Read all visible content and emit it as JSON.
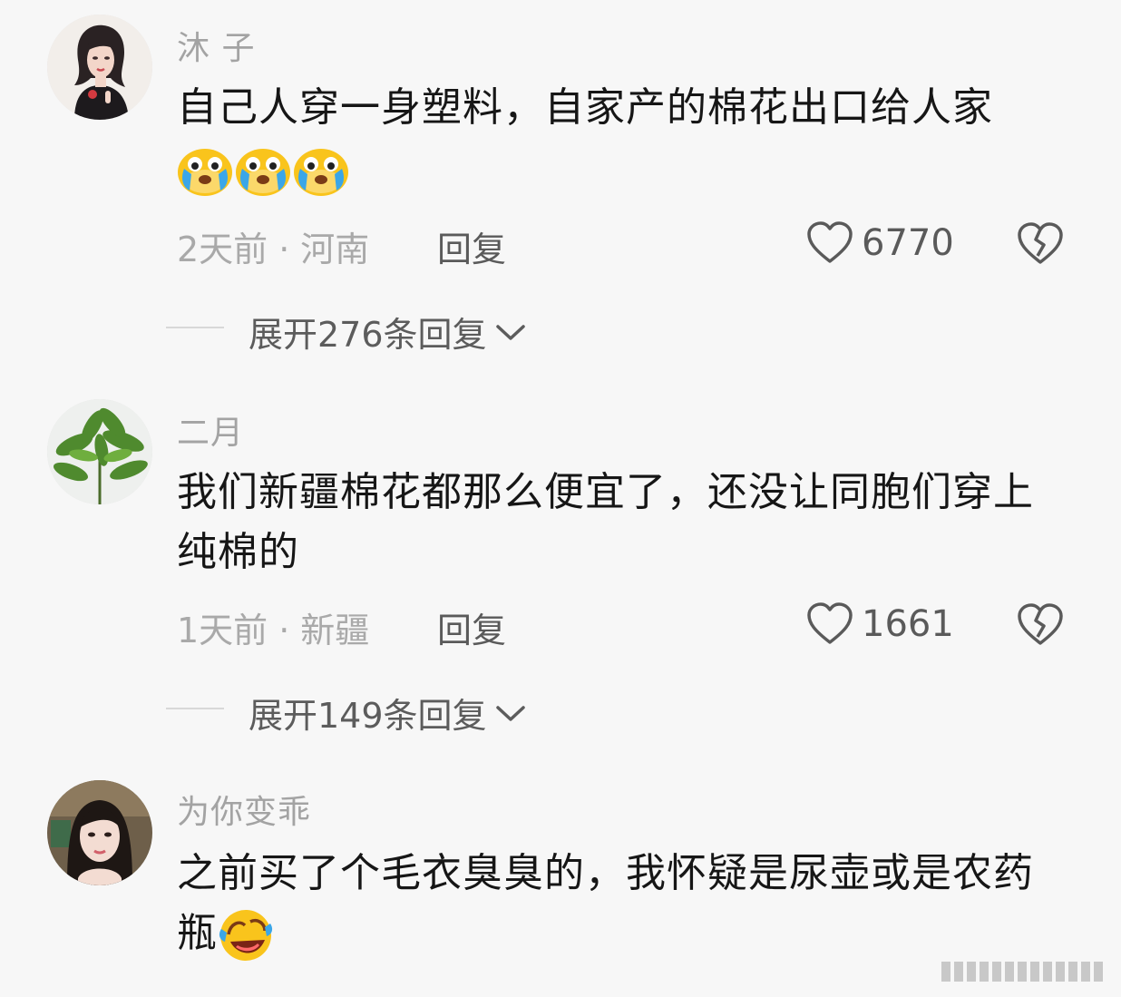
{
  "comments": [
    {
      "username": "沐 子",
      "text": "自己人穿一身塑料，自家产的棉花出口给人家",
      "emojis": [
        "crying-emoji",
        "crying-emoji",
        "crying-emoji"
      ],
      "time": "2天前",
      "location": "河南",
      "reply_label": "回复",
      "likes": "6770",
      "expand_label": "展开276条回复",
      "avatar_icon": "woman-portrait-avatar"
    },
    {
      "username": "二月",
      "text": "我们新疆棉花都那么便宜了，还没让同胞们穿上纯棉的",
      "emojis": [],
      "time": "1天前",
      "location": "新疆",
      "reply_label": "回复",
      "likes": "1661",
      "expand_label": "展开149条回复",
      "avatar_icon": "plant-avatar"
    },
    {
      "username": "为你变乖",
      "text": "之前买了个毛衣臭臭的，我怀疑是尿壶或是农药瓶",
      "emojis": [
        "laughing-crying-emoji"
      ],
      "time": "",
      "location": "",
      "reply_label": "",
      "likes": "",
      "expand_label": "",
      "avatar_icon": "woman-selfie-avatar"
    }
  ],
  "separator_dot": "·",
  "colors": {
    "background": "#f7f7f7",
    "text_primary": "#161616",
    "text_secondary": "#a3a3a3",
    "emoji_yellow": "#f9c41c"
  }
}
